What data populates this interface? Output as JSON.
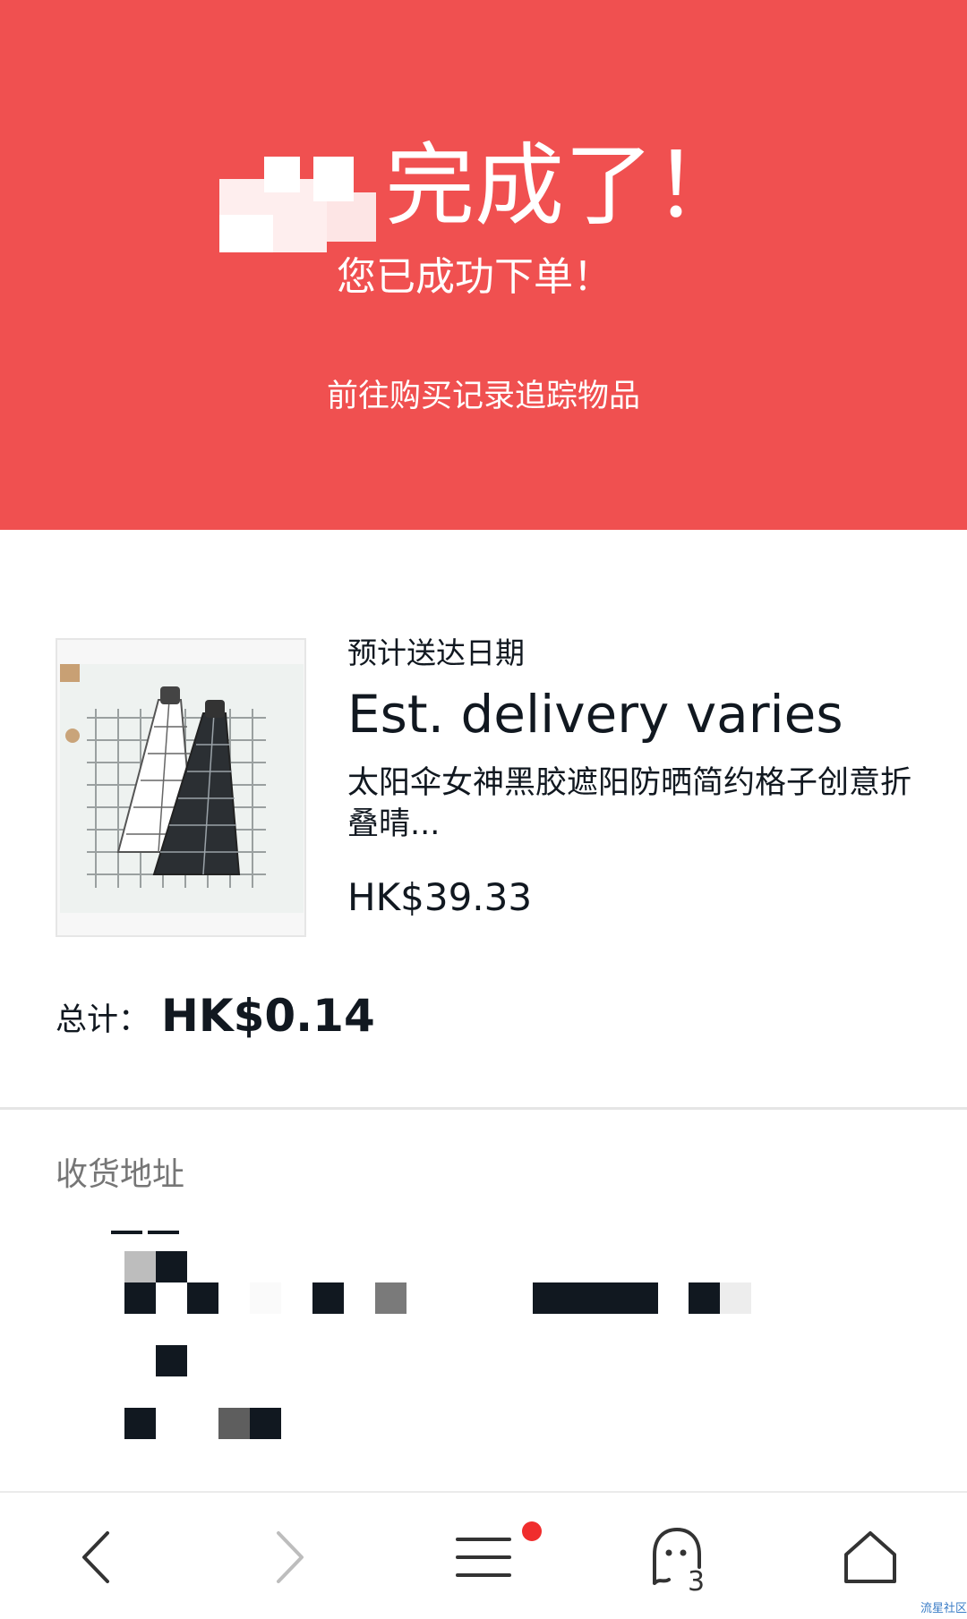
{
  "theme": {
    "accent": "#f05050",
    "text": "#111820",
    "muted": "#767676",
    "dot": "#f02d2d"
  },
  "banner": {
    "headline": "完成了！",
    "subline": "您已成功下单！",
    "link": "前往购买记录追踪物品"
  },
  "order": {
    "eta_label": "预计送达日期",
    "eta_value": "Est. delivery varies",
    "product_title": "太阳伞女神黑胶遮阳防晒简约格子创意折叠晴...",
    "product_price": "HK$39.33",
    "total_label": "总计：",
    "total_value": "HK$0.14"
  },
  "shipping": {
    "label": "收货地址"
  },
  "bottom_nav": {
    "items": [
      {
        "icon": "back-arrow-icon",
        "enabled": true
      },
      {
        "icon": "forward-arrow-icon",
        "enabled": false
      },
      {
        "icon": "menu-icon",
        "has_notification_dot": true
      },
      {
        "icon": "chat-icon",
        "badge": "3"
      },
      {
        "icon": "home-icon"
      }
    ]
  },
  "watermark": "流星社区"
}
